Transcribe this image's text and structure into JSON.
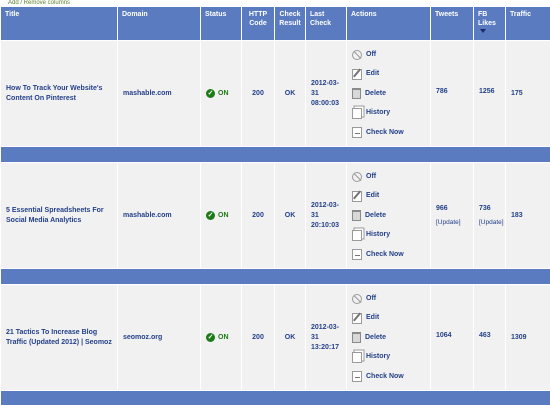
{
  "top_link": "Add / Remove columns",
  "columns": {
    "title": "Title",
    "domain": "Domain",
    "status": "Status",
    "http_code": "HTTP Code",
    "check_result": "Check Result",
    "last_check": "Last Check",
    "actions": "Actions",
    "tweets": "Tweets",
    "fb_likes": "FB Likes",
    "traffic": "Traffic"
  },
  "actions": {
    "off": "Off",
    "edit": "Edit",
    "delete": "Delete",
    "history": "History",
    "check_now": "Check Now"
  },
  "rows": [
    {
      "title": "How To Track Your Website's Content On Pinterest",
      "domain": "mashable.com",
      "status": "ON",
      "http_code": "200",
      "check_result": "OK",
      "last_check": "2012-03-31 08:00:03",
      "tweets": "786",
      "tweets_update": "",
      "fb_likes": "1256",
      "fb_update": "",
      "traffic": "175"
    },
    {
      "title": "5 Essential Spreadsheets For Social Media Analytics",
      "domain": "mashable.com",
      "status": "ON",
      "http_code": "200",
      "check_result": "OK",
      "last_check": "2012-03-31 20:10:03",
      "tweets": "966",
      "tweets_update": "[Update]",
      "fb_likes": "736",
      "fb_update": "[Update]",
      "traffic": "183"
    },
    {
      "title": "21 Tactics To Increase Blog Traffic (Updated 2012) | Seomoz",
      "domain": "seomoz.org",
      "status": "ON",
      "http_code": "200",
      "check_result": "OK",
      "last_check": "2012-03-31 13:20:17",
      "tweets": "1064",
      "tweets_update": "",
      "fb_likes": "463",
      "fb_update": "",
      "traffic": "1309"
    }
  ]
}
